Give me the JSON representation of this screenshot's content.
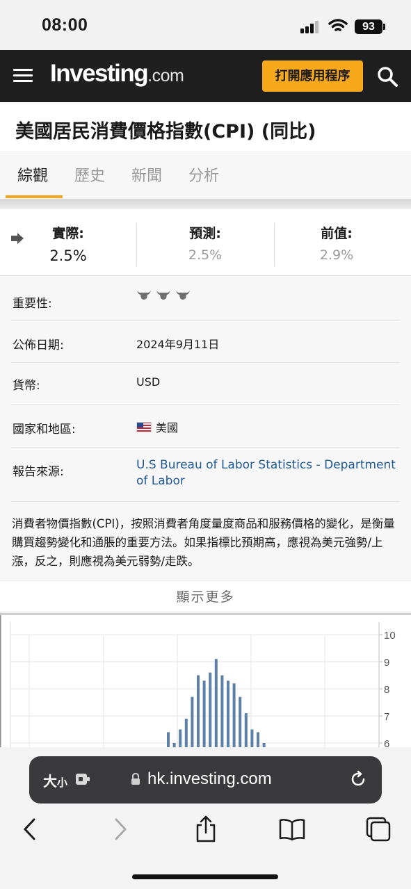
{
  "status_bar": {
    "time": "08:00",
    "battery": "93"
  },
  "header": {
    "logo_main": "Investing",
    "logo_suffix": ".com",
    "open_app_label": "打開應用程序",
    "search_icon": "search-icon",
    "menu_icon": "hamburger-icon"
  },
  "page_title": "美國居民消費價格指數(CPI) (同比)",
  "tabs": [
    {
      "label": "綜觀",
      "active": true
    },
    {
      "label": "歷史",
      "active": false
    },
    {
      "label": "新聞",
      "active": false
    },
    {
      "label": "分析",
      "active": false
    }
  ],
  "stats": {
    "actual": {
      "label": "實際:",
      "value": "2.5%"
    },
    "forecast": {
      "label": "預測:",
      "value": "2.5%"
    },
    "previous": {
      "label": "前值:",
      "value": "2.9%"
    }
  },
  "details": {
    "importance": {
      "label": "重要性:",
      "bulls": 3
    },
    "release_date": {
      "label": "公佈日期:",
      "value": "2024年9月11日"
    },
    "currency": {
      "label": "貨幣:",
      "value": "USD"
    },
    "country": {
      "label": "國家和地區:",
      "value": "美國"
    },
    "source": {
      "label": "報告來源:",
      "value": "U.S Bureau of Labor Statistics - Department of Labor"
    },
    "description": "消費者物價指數(CPI)，按照消費者角度量度商品和服務價格的變化，是衡量購買趨勢變化和通脹的重要方法。如果指標比預期高，應視為美元強勢/上漲，反之，則應視為美元弱勢/走跌。"
  },
  "show_more_label": "顯示更多",
  "chart_data": {
    "type": "bar",
    "y_ticks": [
      "10",
      "9",
      "8",
      "7",
      "6"
    ],
    "ylim_visible": [
      6,
      10
    ],
    "values": [
      6.4,
      6.0,
      6.5,
      6.9,
      7.7,
      8.5,
      8.3,
      8.6,
      9.1,
      8.5,
      8.3,
      8.2,
      7.7,
      7.1,
      6.5,
      6.4,
      6.0
    ],
    "color": "#5b7fa6",
    "grid": true
  },
  "browser": {
    "text_size_label": "大",
    "text_size_small": "小",
    "url": "hk.investing.com"
  }
}
